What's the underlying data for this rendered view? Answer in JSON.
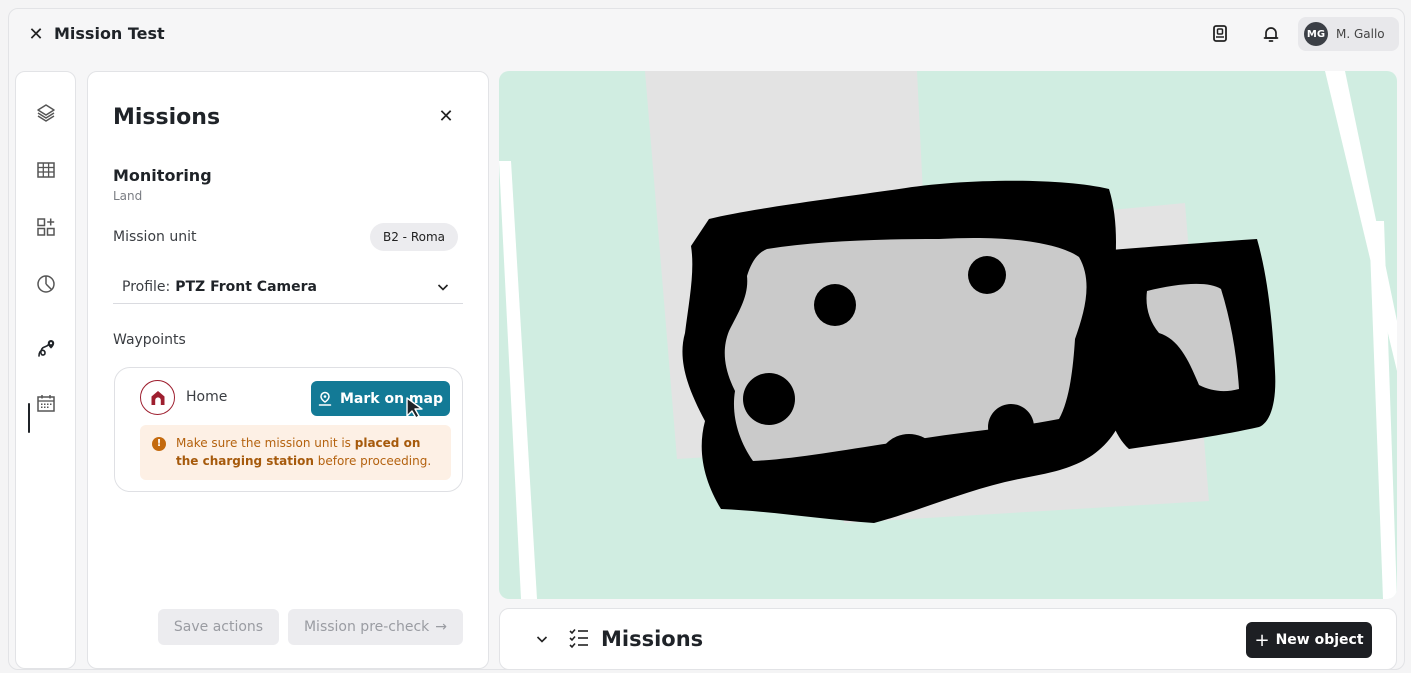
{
  "header": {
    "close_icon": "close-icon",
    "title": "Mission Test",
    "icons": [
      "badge-icon",
      "bell-icon"
    ],
    "user": {
      "initials": "MG",
      "name": "M. Gallo"
    }
  },
  "rail": {
    "items": [
      {
        "icon": "layers-icon"
      },
      {
        "icon": "table-icon"
      },
      {
        "icon": "widgets-icon"
      },
      {
        "icon": "clock-icon"
      },
      {
        "icon": "route-pin-icon",
        "active": true
      },
      {
        "icon": "calendar-icon"
      }
    ]
  },
  "panel": {
    "title": "Missions",
    "mission_name": "Monitoring",
    "mission_type": "Land",
    "unit_label": "Mission unit",
    "unit_value": "B2 - Roma",
    "profile_prefix": "Profile:",
    "profile_value": "PTZ Front Camera",
    "waypoints_label": "Waypoints",
    "waypoint": {
      "label": "Home",
      "mark_button": "Mark on map",
      "warning_pre": "Make sure the mission unit is ",
      "warning_bold": "placed on the charging station",
      "warning_post": " before proceeding."
    },
    "save_actions": "Save actions",
    "pre_check": "Mission pre-check",
    "pre_check_arrow": "→"
  },
  "bottom": {
    "title": "Missions",
    "new_button": "New object",
    "new_plus": "+"
  },
  "colors": {
    "accent": "#137a96",
    "home_icon": "#9e1f2f",
    "warning_bg": "#fdf0e5",
    "warning_text": "#b4620f",
    "map_green": "#d0ede1",
    "map_gray": "#e2e2e2",
    "map_black": "#000000"
  }
}
